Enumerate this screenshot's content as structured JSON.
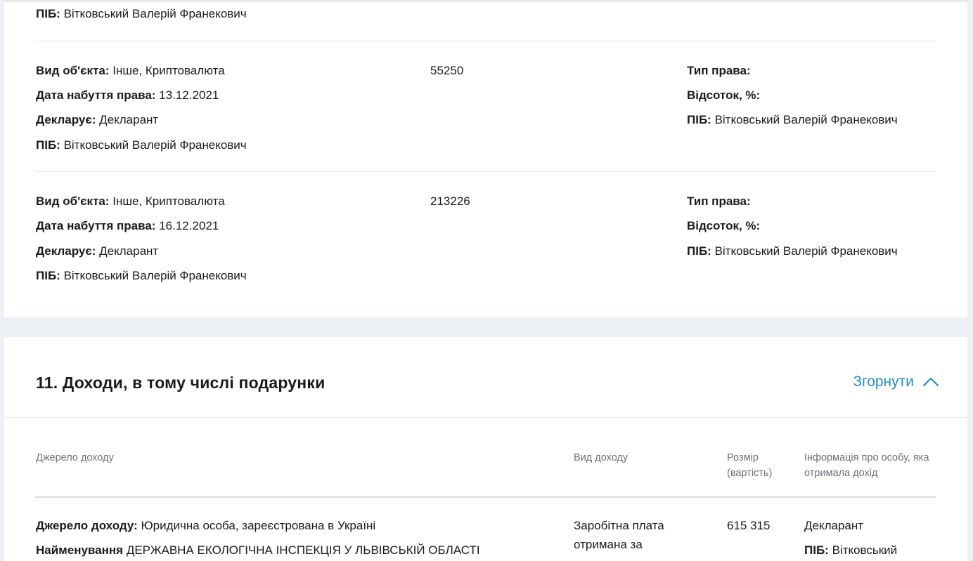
{
  "assets": {
    "top_pib": {
      "label": "ПІБ:",
      "value": "Вітковський Валерій Франекович"
    },
    "rows": [
      {
        "object_type": {
          "label": "Вид об'єкта:",
          "value": "Інше, Криптовалюта"
        },
        "acquired": {
          "label": "Дата набуття права:",
          "value": "13.12.2021"
        },
        "declares": {
          "label": "Декларує:",
          "value": "Декларант"
        },
        "pib": {
          "label": "ПІБ:",
          "value": "Вітковський Валерій Франекович"
        },
        "amount": "55250",
        "right_type": {
          "label": "Тип права:",
          "value": ""
        },
        "percent": {
          "label": "Відсоток, %:",
          "value": ""
        },
        "owner_pib": {
          "label": "ПІБ:",
          "value": "Вітковський Валерій Франекович"
        }
      },
      {
        "object_type": {
          "label": "Вид об'єкта:",
          "value": "Інше, Криптовалюта"
        },
        "acquired": {
          "label": "Дата набуття права:",
          "value": "16.12.2021"
        },
        "declares": {
          "label": "Декларує:",
          "value": "Декларант"
        },
        "pib": {
          "label": "ПІБ:",
          "value": "Вітковський Валерій Франекович"
        },
        "amount": "213226",
        "right_type": {
          "label": "Тип права:",
          "value": ""
        },
        "percent": {
          "label": "Відсоток, %:",
          "value": ""
        },
        "owner_pib": {
          "label": "ПІБ:",
          "value": "Вітковський Валерій Франекович"
        }
      }
    ]
  },
  "income": {
    "title": "11. Доходи, в тому числі подарунки",
    "collapse_label": "Згорнути",
    "columns": {
      "source": "Джерело доходу",
      "type": "Вид доходу",
      "amount": "Розмір (вартість)",
      "person": "Інформація про особу, яка отримала дохід"
    },
    "rows": [
      {
        "source": {
          "label": "Джерело доходу:",
          "value": "Юридична особа, зареєстрована в Україні"
        },
        "name": {
          "label": "Найменування",
          "value": "ДЕРЖАВНА ЕКОЛОГІЧНА ІНСПЕКЦІЯ У ЛЬВІВСЬКІЙ ОБЛАСТІ"
        },
        "type": "Заробітна плата отримана за",
        "amount": "615 315",
        "person": "Декларант",
        "person_pib": {
          "label": "ПІБ:",
          "value": "Вітковський"
        }
      }
    ]
  },
  "colors": {
    "page_bg": "#edf0f4",
    "card_bg": "#ffffff",
    "accent": "#1f8fcf",
    "muted_text": "#6b7077"
  },
  "icons": {
    "collapse": "chevron-up-icon"
  }
}
